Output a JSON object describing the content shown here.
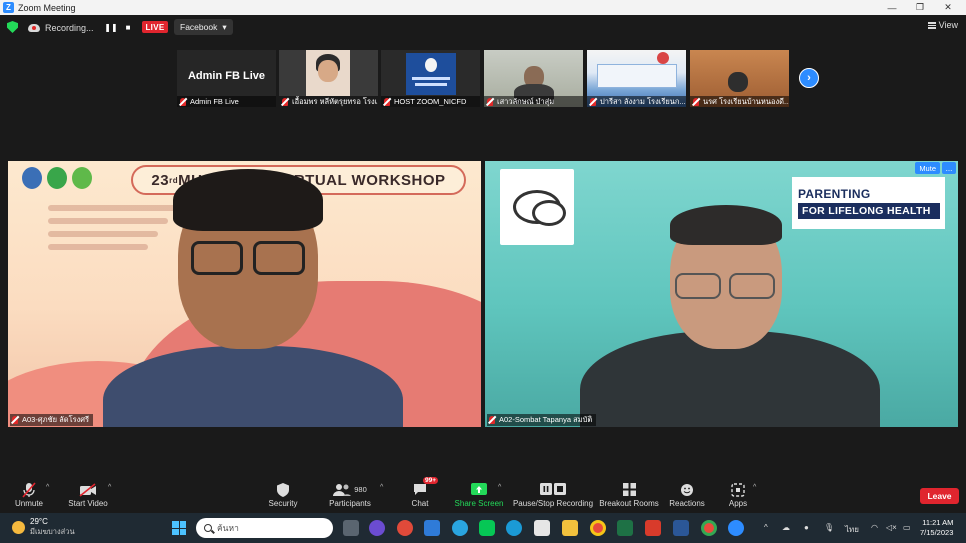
{
  "window": {
    "title": "Zoom Meeting"
  },
  "topbar": {
    "recording_label": "Recording...",
    "live_label": "LIVE",
    "stream_target": "Facebook",
    "view_label": "View"
  },
  "thumbnails": [
    {
      "name": "Admin FB Live",
      "label": "Admin FB Live"
    },
    {
      "name": "",
      "label": "เอื้อมพร หลีหัตรุยทรอ โรงเ..."
    },
    {
      "name": "",
      "label": "HOST ZOOM_NICFD"
    },
    {
      "name": "",
      "label": "เสาวลักษณ์ บำสุ่ม"
    },
    {
      "name": "",
      "label": "ปารีสา ลังงาม โรงเรียนก..."
    },
    {
      "name": "",
      "label": "นรศ โรงเรียนบ้านหนองดี..."
    }
  ],
  "main_tiles": {
    "left": {
      "label": "A03-ศุภชัย ลัดโรงศรี",
      "banner_main": "23",
      "banner_sup": "rd",
      "banner_rest": " MU SCHOOL VIRTUAL WORKSHOP"
    },
    "right": {
      "label": "A02-Sombat Tapanya สมบัติ",
      "mute_label": "Mute",
      "more_label": "...",
      "brand_line1": "PARENTING",
      "brand_line2": "FOR LIFELONG HEALTH"
    }
  },
  "toolbar": {
    "unmute": "Unmute",
    "start_video": "Start Video",
    "security": "Security",
    "participants": "Participants",
    "participants_count": "980",
    "chat": "Chat",
    "chat_badge": "99+",
    "share_screen": "Share Screen",
    "pause_recording": "Pause/Stop Recording",
    "breakout_rooms": "Breakout Rooms",
    "reactions": "Reactions",
    "apps": "Apps",
    "leave": "Leave"
  },
  "taskbar": {
    "temperature": "29°C",
    "weather_desc": "มีเมฆบางส่วน",
    "search_placeholder": "ค้นหา",
    "language": "ไทย",
    "time": "11:21 AM",
    "date": "7/15/2023"
  },
  "colors": {
    "zoom_blue": "#2d8cff",
    "live_red": "#e0252e",
    "share_green": "#23d959",
    "toolbar_bg": "#1a1a1a"
  }
}
